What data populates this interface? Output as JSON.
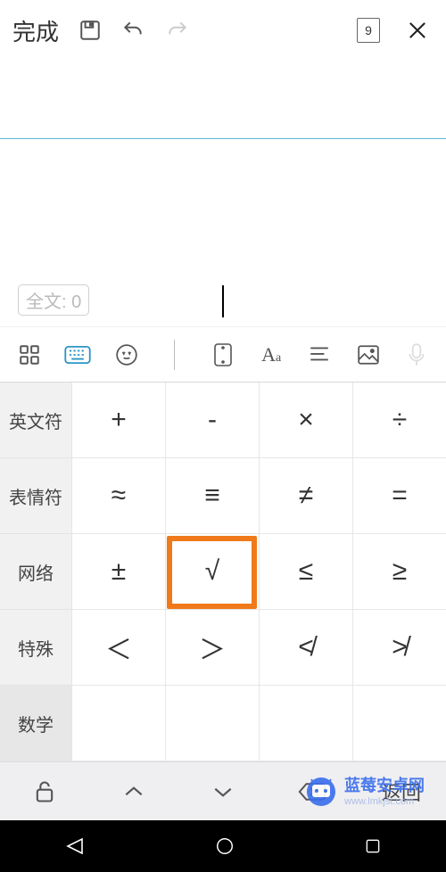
{
  "topbar": {
    "done_label": "完成",
    "font_size_value": "9"
  },
  "word_count": {
    "label": "全文: 0"
  },
  "categories": {
    "items": [
      {
        "label": "英文符"
      },
      {
        "label": "表情符"
      },
      {
        "label": "网络"
      },
      {
        "label": "特殊"
      },
      {
        "label": "数学"
      }
    ],
    "active_index": 4
  },
  "symbols": {
    "rows": [
      [
        "+",
        "-",
        "×",
        "÷"
      ],
      [
        "≈",
        "≡",
        "≠",
        "="
      ],
      [
        "±",
        "√",
        "≤",
        "≥"
      ],
      [
        "＜",
        "＞",
        "≮",
        "≯"
      ]
    ],
    "highlighted": {
      "row": 2,
      "col": 1
    }
  },
  "imebar": {
    "back_label": "返回"
  },
  "watermark": {
    "brand": "蓝莓安卓网",
    "url": "www.lmkjst.com"
  }
}
